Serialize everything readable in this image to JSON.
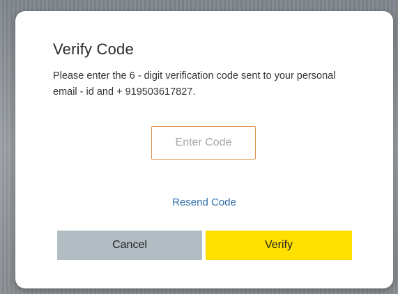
{
  "dialog": {
    "title": "Verify Code",
    "description": "Please enter the 6 - digit verification code sent to your personal email - id and + 919503617827.",
    "code_input": {
      "placeholder": "Enter Code",
      "value": ""
    },
    "resend_label": "Resend Code",
    "cancel_label": "Cancel",
    "verify_label": "Verify"
  },
  "colors": {
    "input_border": "#e0924a",
    "link": "#2f6ea8",
    "cancel_bg": "#b2bcc3",
    "verify_bg": "#ffe000"
  }
}
